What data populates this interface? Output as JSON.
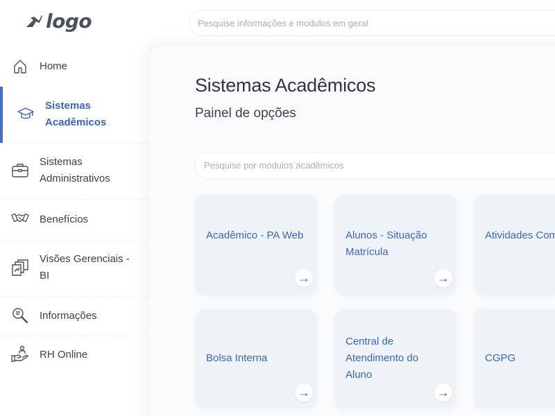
{
  "header": {
    "logo_text": "logo",
    "search_placeholder": "Pesquise informações e modulos em geral"
  },
  "sidebar": {
    "items": [
      {
        "label": "Home",
        "icon": "home-icon"
      },
      {
        "label": "Sistemas Acadêmicos",
        "icon": "graduation-cap-icon",
        "active": true
      },
      {
        "label": "Sistemas Administrativos",
        "icon": "briefcase-icon"
      },
      {
        "label": "Benefícios",
        "icon": "handshake-icon"
      },
      {
        "label": "Visões Gerenciais - BI",
        "icon": "reports-icon"
      },
      {
        "label": "Informações",
        "icon": "magnifier-icon"
      },
      {
        "label": "RH Online",
        "icon": "hand-person-icon"
      }
    ]
  },
  "main": {
    "title": "Sistemas Acadêmicos",
    "subtitle": "Painel de opções",
    "search_placeholder": "Pesquise por módulos acadêmicos",
    "cards": [
      {
        "title": "Acadêmico - PA Web"
      },
      {
        "title": "Alunos - Situação Matrícula"
      },
      {
        "title": "Atividades Complementares"
      },
      {
        "title": "Bolsa Interna"
      },
      {
        "title": "Central de Atendimento do Aluno"
      },
      {
        "title": "CGPG"
      }
    ],
    "card_arrow": "→"
  },
  "colors": {
    "accent": "#3f6fd6",
    "card_bg": "#eef3f8",
    "card_text": "#3e63c2"
  }
}
